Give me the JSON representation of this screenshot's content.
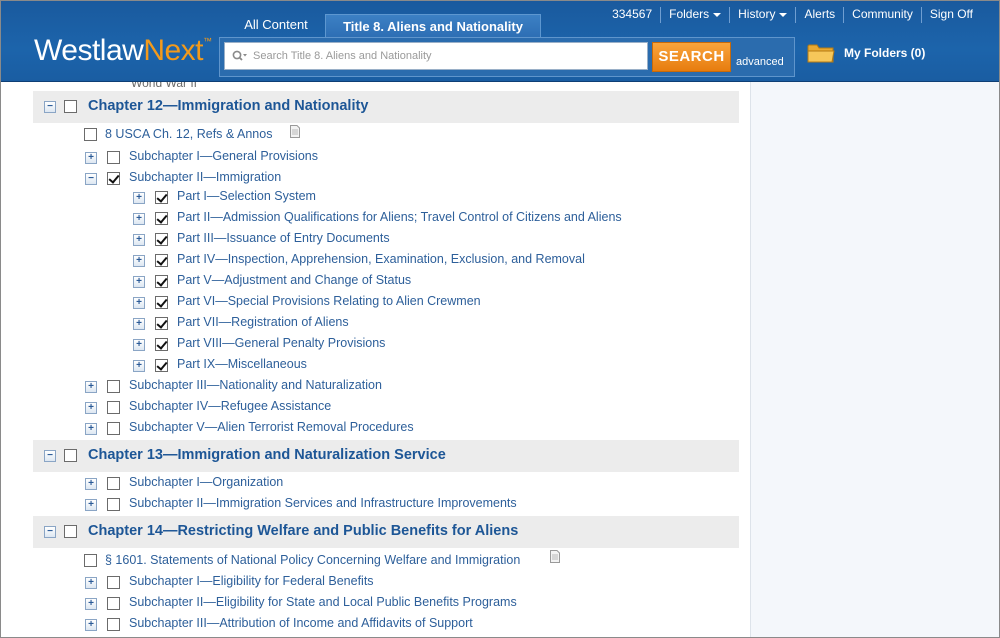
{
  "header": {
    "logo": {
      "brand": "Westlaw",
      "suffix": "Next",
      "mark": "™"
    },
    "tabs": [
      {
        "label": "All Content"
      },
      {
        "label": "Title 8. Aliens and Nationality"
      }
    ],
    "search": {
      "placeholder": "Search Title 8. Aliens and Nationality",
      "button_label": "SEARCH",
      "advanced_label": "advanced"
    },
    "topnav": [
      {
        "label": "334567"
      },
      {
        "label": "Folders"
      },
      {
        "label": "History"
      },
      {
        "label": "Alerts"
      },
      {
        "label": "Community"
      },
      {
        "label": "Sign Off"
      }
    ],
    "my_folders": "My Folders (0)"
  },
  "toc": {
    "cutoff_text": "World War II",
    "chapter12": {
      "label": "Chapter 12—Immigration and Nationality",
      "refs": "8 USCA Ch. 12, Refs & Annos",
      "sub1": "Subchapter I—General Provisions",
      "sub2": "Subchapter II—Immigration",
      "parts": [
        "Part  I—Selection System",
        "Part  II—Admission Qualifications for Aliens;  Travel Control of Citizens and Aliens",
        "Part  III—Issuance of Entry Documents",
        "Part  IV—Inspection, Apprehension, Examination, Exclusion, and Removal",
        "Part  V—Adjustment and Change of Status",
        "Part  VI—Special Provisions Relating to Alien Crewmen",
        "Part  VII—Registration of Aliens",
        "Part  VIII—General Penalty Provisions",
        "Part  IX—Miscellaneous"
      ],
      "sub3": "Subchapter III—Nationality and Naturalization",
      "sub4": "Subchapter IV—Refugee Assistance",
      "sub5": "Subchapter V—Alien Terrorist Removal Procedures"
    },
    "chapter13": {
      "label": "Chapter 13—Immigration and Naturalization Service",
      "sub1": "Subchapter I—Organization",
      "sub2": "Subchapter II—Immigration Services and Infrastructure Improvements"
    },
    "chapter14": {
      "label": "Chapter 14—Restricting Welfare and Public Benefits for Aliens",
      "section": "§ 1601. Statements of National Policy Concerning Welfare and Immigration",
      "sub1": "Subchapter I—Eligibility for Federal Benefits",
      "sub2": "Subchapter II—Eligibility for State and Local Public Benefits Programs",
      "sub3": "Subchapter III—Attribution of Income and Affidavits of Support"
    }
  },
  "colors": {
    "header_blue": "#1c64ab",
    "accent_orange": "#f39a1b",
    "link_blue": "#2d5f9a",
    "chapter_band": "#ececec"
  }
}
